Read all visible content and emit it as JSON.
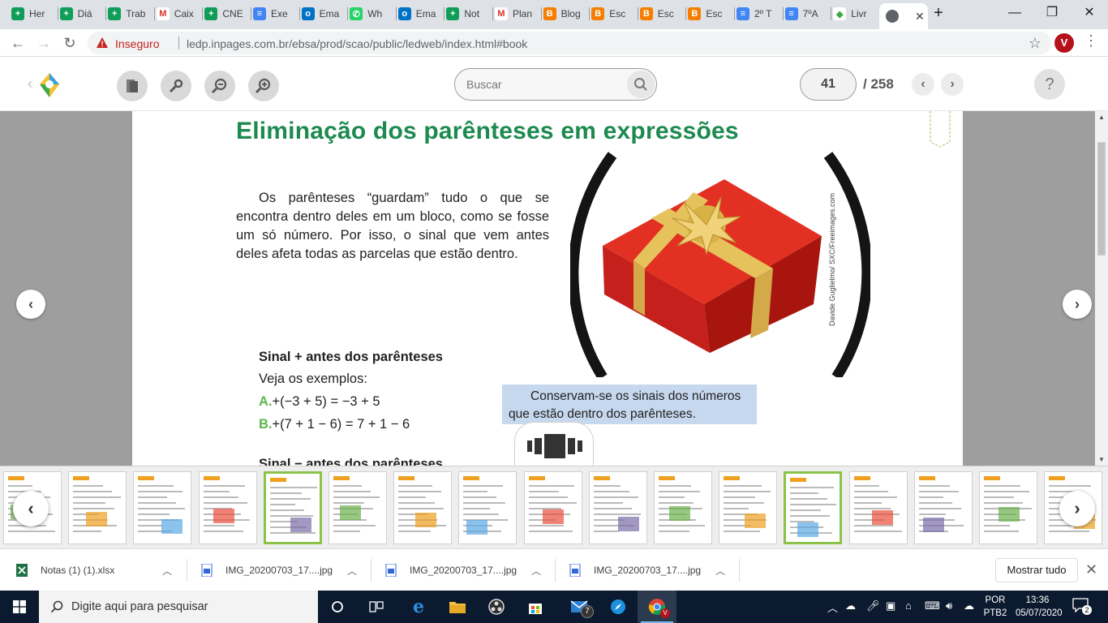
{
  "browser": {
    "tabs": [
      {
        "title": "Her",
        "icon": "plus-green"
      },
      {
        "title": "Diá",
        "icon": "plus-green"
      },
      {
        "title": "Trab",
        "icon": "plus-green"
      },
      {
        "title": "Caix",
        "icon": "gmail"
      },
      {
        "title": "CNE",
        "icon": "plus-green"
      },
      {
        "title": "Exe",
        "icon": "docs-blue"
      },
      {
        "title": "Ema",
        "icon": "outlook"
      },
      {
        "title": "Wh",
        "icon": "whatsapp"
      },
      {
        "title": "Ema",
        "icon": "outlook"
      },
      {
        "title": "Not",
        "icon": "plus-green"
      },
      {
        "title": "Plan",
        "icon": "gmail"
      },
      {
        "title": "Blog",
        "icon": "blogger"
      },
      {
        "title": "Esc",
        "icon": "blogger"
      },
      {
        "title": "Esc",
        "icon": "blogger"
      },
      {
        "title": "Esc",
        "icon": "blogger"
      },
      {
        "title": "2º T",
        "icon": "docs-blue"
      },
      {
        "title": "7ºA",
        "icon": "docs-blue"
      },
      {
        "title": "Livr",
        "icon": "ledp"
      }
    ],
    "insecure_label": "Inseguro",
    "url": "ledp.inpages.com.br/ebsa/prod/scao/public/ledweb/index.html#book",
    "profile_initial": "V"
  },
  "reader": {
    "search_placeholder": "Buscar",
    "current_page": "41",
    "total_pages": "/ 258",
    "help": "?"
  },
  "page": {
    "title": "Eliminação dos parênteses em expressões",
    "intro": "Os parênteses “guardam” tudo o que se encontra dentro deles em um bloco, como se fosse um só número. Por isso, o sinal que vem antes deles afeta todas as parcelas que estão dentro.",
    "section_title": "Sinal + antes dos parênteses",
    "examples_intro": "Veja os exemplos:",
    "examples": [
      {
        "label": "A.",
        "expr": "+(−3 + 5) = −3 + 5"
      },
      {
        "label": "B.",
        "expr": "+(7 + 1 − 6) = 7 + 1 − 6"
      }
    ],
    "callout": "Conservam-se os sinais dos números que estão dentro dos parênteses.",
    "credit": "Davide Guglielmo/ SXC/Freeimages.com",
    "next_heading": "Sinal − antes dos parênteses"
  },
  "downloads": {
    "items": [
      {
        "name": "Notas (1) (1).xlsx",
        "type": "excel"
      },
      {
        "name": "IMG_20200703_17....jpg",
        "type": "image"
      },
      {
        "name": "IMG_20200703_17....jpg",
        "type": "image"
      },
      {
        "name": "IMG_20200703_17....jpg",
        "type": "image"
      }
    ],
    "show_all": "Mostrar tudo"
  },
  "taskbar": {
    "search_placeholder": "Digite aqui para pesquisar",
    "mail_badge": "7",
    "lang": "POR",
    "lang2": "PTB2",
    "time": "13:36",
    "date": "05/07/2020",
    "notifications": "2"
  },
  "colors": {
    "title_green": "#1d8a4f",
    "example_label_green": "#5fb64a",
    "callout_bg": "#c6d8ee",
    "selected_thumb": "#8bc34a"
  }
}
